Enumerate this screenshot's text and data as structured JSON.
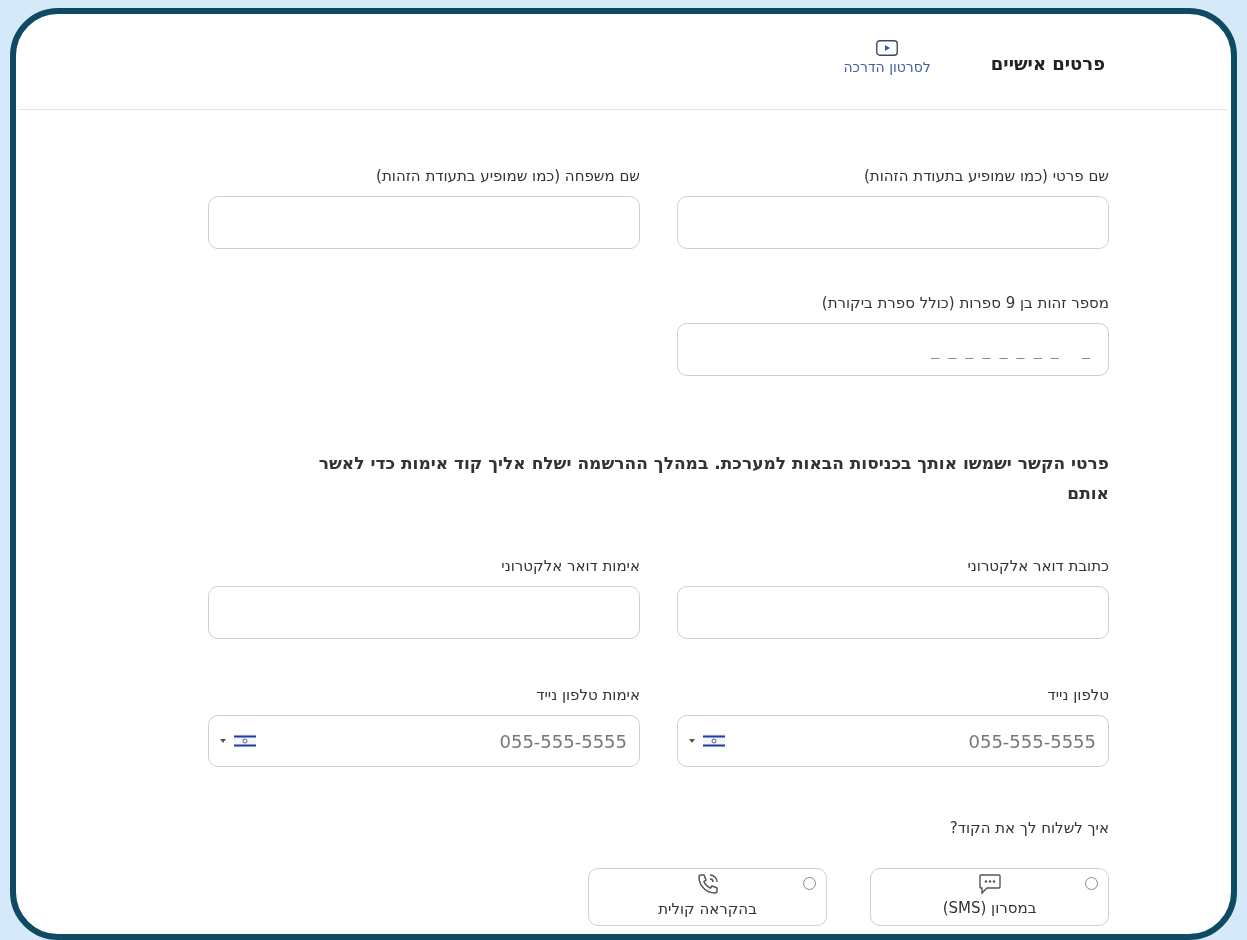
{
  "header": {
    "title": "פרטים אישיים",
    "video_link": "לסרטון הדרכה"
  },
  "personal_fields": [
    {
      "label": "שם פרטי (כמו שמופיע בתעודת הזהות)",
      "kind": "text"
    },
    {
      "label": "שם משפחה (כמו שמופיע בתעודת הזהות)",
      "kind": "text"
    },
    {
      "label": "מספר זהות בן 9 ספרות (כולל ספרת ביקורת)",
      "kind": "text",
      "placeholder": "_ _ _ _ _ _ _ _   _"
    }
  ],
  "contact_note": "פרטי הקשר ישמשו אותך בכניסות הבאות למערכת. במהלך ההרשמה ישלח אליך קוד אימות כדי לאשר אותם",
  "contact_fields": [
    {
      "label": "כתובת דואר אלקטרוני",
      "kind": "text"
    },
    {
      "label": "אימות דואר אלקטרוני",
      "kind": "text"
    },
    {
      "label": "טלפון נייד",
      "kind": "phone",
      "placeholder": "055-555-5555"
    },
    {
      "label": "אימות טלפון נייד",
      "kind": "phone",
      "placeholder": "055-555-5555"
    }
  ],
  "code_question": "איך לשלוח לך את הקוד?",
  "code_options": [
    {
      "label": "במסרון (SMS)",
      "kind": "sms",
      "selected": false
    },
    {
      "label": "בהקראה קולית",
      "kind": "voice",
      "selected": false
    }
  ]
}
